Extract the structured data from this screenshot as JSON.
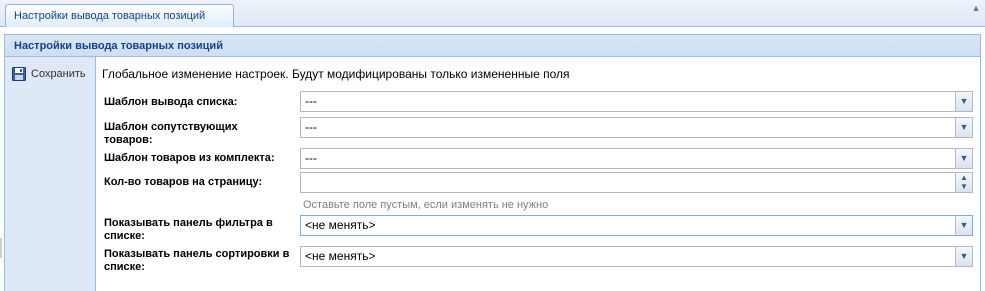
{
  "tab": {
    "title": "Настройки вывода товарных позиций"
  },
  "panel": {
    "title": "Настройки вывода товарных позиций",
    "notice": "Глобальное изменение настроек. Будут модифицированы только измененные поля"
  },
  "toolbar": {
    "save_label": "Сохранить",
    "save_icon": "floppy-disk-icon"
  },
  "fields": {
    "list_template": {
      "label": "Шаблон вывода списка:",
      "value": "---"
    },
    "related_template": {
      "label": "Шаблон сопутствующих товаров:",
      "value": "---"
    },
    "kit_template": {
      "label": "Шаблон товаров из комплекта:",
      "value": "---"
    },
    "per_page": {
      "label": "Кол-во товаров на страницу:",
      "value": "",
      "hint": "Оставьте поле пустым, если изменять не нужно"
    },
    "filter_panel": {
      "label": "Показывать панель фильтра в списке:",
      "value": "<не менять>"
    },
    "sort_panel": {
      "label": "Показывать панель сортировки в списке:",
      "value": "<не менять>"
    }
  },
  "colors": {
    "accent": "#15428b",
    "border": "#99bbe8",
    "header_bg": "#dae7f6"
  }
}
